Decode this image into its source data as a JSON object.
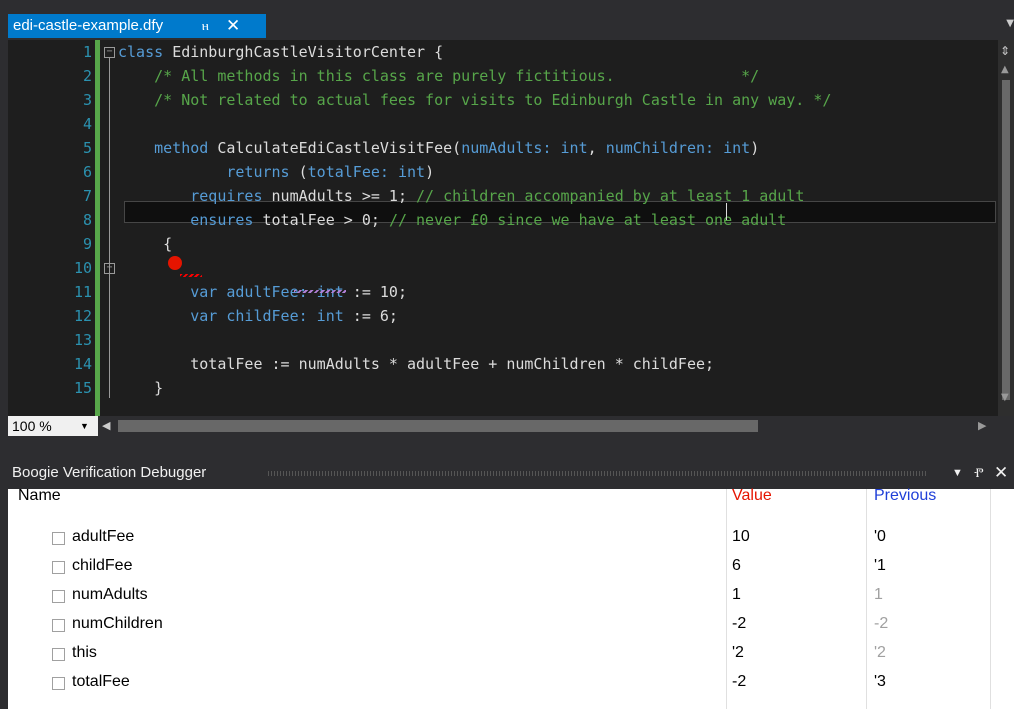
{
  "tab": {
    "filename": "edi-castle-example.dfy",
    "pin_glyph": "ⲏ",
    "close_glyph": "✕"
  },
  "editor": {
    "line_numbers": [
      "1",
      "2",
      "3",
      "4",
      "5",
      "6",
      "7",
      "8",
      "9",
      "10",
      "11",
      "12",
      "13",
      "14",
      "15"
    ],
    "lines": [
      "class EdinburghCastleVisitorCenter {",
      "    /* All methods in this class are purely fictitious.              */",
      "    /* Not related to actual fees for visits to Edinburgh Castle in any way. */",
      "",
      "    method CalculateEdiCastleVisitFee(numAdults: int, numChildren: int)",
      "            returns (totalFee: int)",
      "        requires numAdults >= 1; // children accompanied by at least 1 adult",
      "        ensures totalFee > 0; // never £0 since we have at least one adult",
      "     {",
      "        var adultFee: int := 10;",
      "        var childFee: int := 6;",
      "",
      "        totalFee := numAdults * adultFee + numChildren * childFee;",
      "    }",
      ""
    ]
  },
  "zoom": {
    "level": "100 %"
  },
  "debugger": {
    "title": "Boogie Verification Debugger",
    "columns": {
      "name": "Name",
      "value": "Value",
      "previous": "Previous"
    },
    "header_colors": {
      "value": "#e51400",
      "previous": "#1f3fd8"
    },
    "rows": [
      {
        "name": "adultFee",
        "value": "10",
        "previous": "'0",
        "prev_dim": false
      },
      {
        "name": "childFee",
        "value": "6",
        "previous": "'1",
        "prev_dim": false
      },
      {
        "name": "numAdults",
        "value": "1",
        "previous": "1",
        "prev_dim": true
      },
      {
        "name": "numChildren",
        "value": "-2",
        "previous": "-2",
        "prev_dim": true
      },
      {
        "name": "this",
        "value": "'2",
        "previous": "'2",
        "prev_dim": true
      },
      {
        "name": "totalFee",
        "value": "-2",
        "previous": "'3",
        "prev_dim": false
      }
    ]
  }
}
